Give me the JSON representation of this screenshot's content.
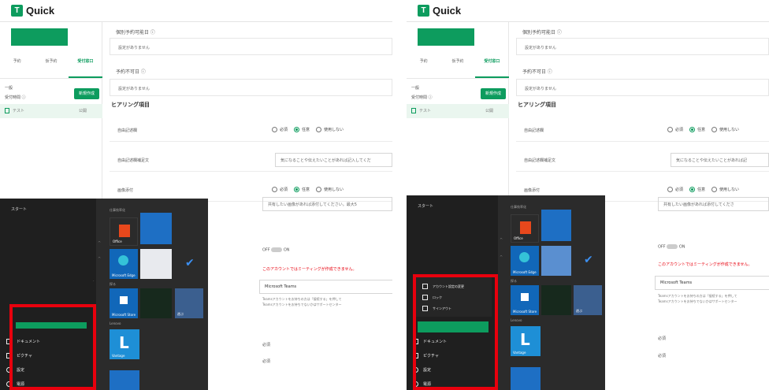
{
  "app": {
    "name": "Quick",
    "logo_letter": "T"
  },
  "sidebar": {
    "tabs": [
      "予約",
      "仮予約",
      "受付窓口"
    ],
    "active_tab": 2,
    "general_label": "一般",
    "window_label": "受付時間 ⓘ",
    "new_button": "新規作成",
    "item_label": "テスト",
    "item_status": "公開"
  },
  "content": {
    "available_title": "個別予約可能日 ⓘ",
    "available_value": "設定がありません",
    "unavailable_title": "予約不可日 ⓘ",
    "unavailable_value": "設定がありません",
    "hearing_section": "ヒアリング項目",
    "free_field_label": "自由記述欄",
    "free_text_label": "自由記述欄補足文",
    "free_text_placeholder": "気になることや伝えたいことがあれば記入してくだ",
    "free_text_placeholder_b": "気になることや伝えたいことがあれば記",
    "image_label": "画像添付",
    "image_placeholder": "共有したい画像があれば添付してください。最大5",
    "image_placeholder_b": "共有したい画像があれば添付してくださ",
    "radio_required": "必須",
    "radio_optional": "任意",
    "radio_unused": "使用しない",
    "toggle_off": "OFF",
    "toggle_on": "ON",
    "teams_warning": "このアカウントではミーティングが作成できません。",
    "teams_value": "Microsoft Teams",
    "teams_note_1": "Teamsアカウントをお持ちの方は「接続する」を押して",
    "teams_note_2": "Teamsアカウントをお持ちでないかはサポートセンター",
    "req_label": "必須"
  },
  "startmenu": {
    "start": "スタート",
    "group_productivity": "仕事効率化",
    "group_explore": "探る",
    "group_lenovo": "Lenovo",
    "tile_office": "Office",
    "tile_edge": "Microsoft Edge",
    "tile_store": "Microsoft Store",
    "tile_play": "遊ぶ",
    "tile_vantage": "Vantage",
    "documents": "ドキュメント",
    "pictures": "ピクチャ",
    "settings": "設定",
    "power": "電源",
    "account_settings": "アカウント設定の変更",
    "lock": "ロック",
    "sign_out": "サインアウト"
  },
  "colors": {
    "accent": "#0d9c5e",
    "highlight_border": "#e8000d"
  }
}
